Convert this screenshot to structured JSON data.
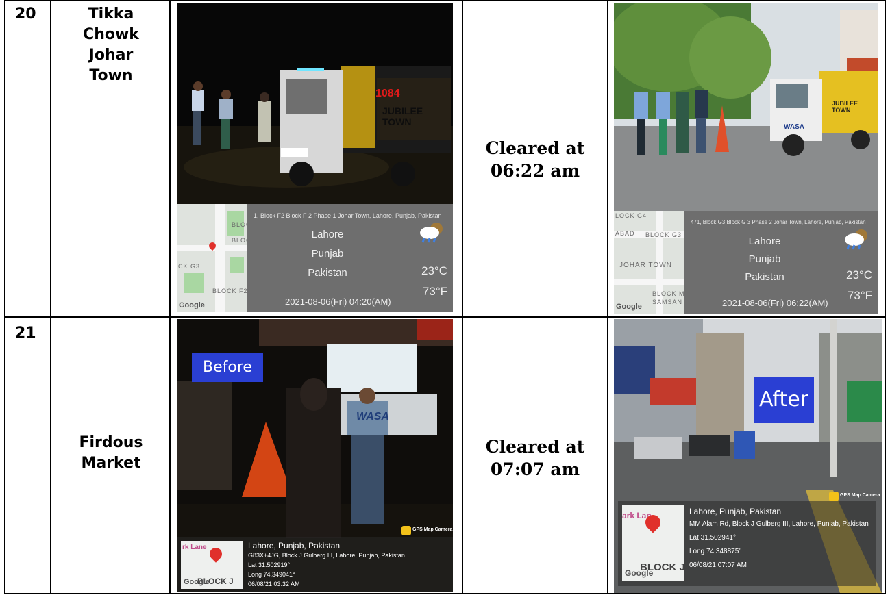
{
  "rows": [
    {
      "number": "20",
      "location_lines": [
        "Tikka",
        "Chowk",
        "Johar",
        "Town"
      ],
      "status_lines": [
        "Cleared at",
        "06:22 am"
      ],
      "before_photo": {
        "address": "1, Block F2 Block F 2 Phase 1 Johar Town, Lahore, Punjab, Pakistan",
        "city": "Lahore",
        "province": "Punjab",
        "country": "Pakistan",
        "temp_c": "23°C",
        "temp_f": "73°F",
        "datetime": "2021-08-06(Fri)  04:20(AM)",
        "map_labels": [
          "BLOC",
          "BLOC",
          "CK G3",
          "BLOCK F2"
        ],
        "google": "Google",
        "truck_number": "1084",
        "truck_text": "JUBILEE TOWN"
      },
      "after_photo": {
        "address": "471, Block G3 Block G 3 Phase 2 Johar Town, Lahore, Punjab, Pakistan",
        "city": "Lahore",
        "province": "Punjab",
        "country": "Pakistan",
        "temp_c": "23°C",
        "temp_f": "73°F",
        "datetime": "2021-08-06(Fri)  06:22(AM)",
        "map_labels": [
          "LOCK G4",
          "ABAD",
          "BLOCK G3",
          "JOHAR TOWN",
          "BLOCK M",
          "SAMSAN"
        ],
        "google": "Google",
        "truck_text": "JUBILEE TOWN",
        "truck_brand": "WASA"
      }
    },
    {
      "number": "21",
      "location_lines": [
        "Firdous",
        "Market"
      ],
      "status_lines": [
        "Cleared at",
        "07:07 am"
      ],
      "before_photo": {
        "tag": "Before",
        "title": "Lahore, Punjab, Pakistan",
        "address": "G83X+4JG, Block J Gulberg III, Lahore, Punjab, Pakistan",
        "lat": "Lat 31.502919°",
        "long": "Long 74.349041°",
        "datetime": "06/08/21 03:32 AM",
        "map_labels": [
          "rk Lane",
          "BLOCK J"
        ],
        "google": "Google",
        "gps_camera": "GPS Map Camera",
        "shirt_text": "WASA"
      },
      "after_photo": {
        "tag": "After",
        "title": "Lahore, Punjab, Pakistan",
        "address": "MM Alam Rd, Block J Gulberg III, Lahore, Punjab, Pakistan",
        "lat": "Lat 31.502941°",
        "long": "Long 74.348875°",
        "datetime": "06/08/21 07:07 AM",
        "map_labels": [
          "ark Lan",
          "BLOCK J"
        ],
        "google": "Google",
        "gps_camera": "GPS Map Camera"
      }
    }
  ]
}
